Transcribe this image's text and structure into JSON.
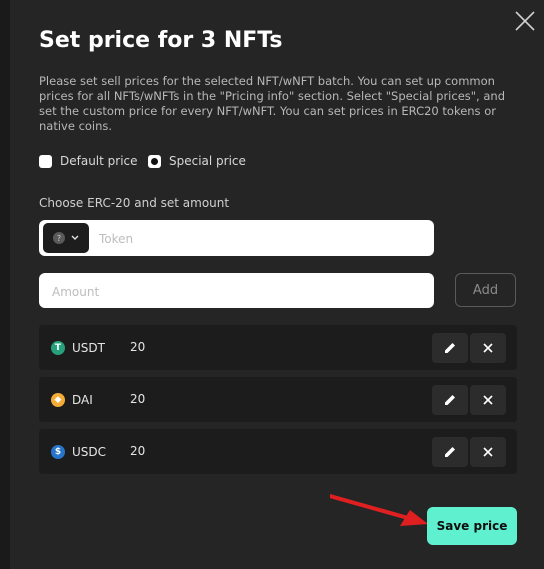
{
  "modal": {
    "title": "Set price for 3 NFTs",
    "description": "Please set sell prices for the selected NFT/wNFT batch. You can set up common prices for all NFTs/wNFTs in the \"Pricing info\" section. Select \"Special prices\", and set the custom price for every NFT/wNFT. You can set prices in ERC20 tokens or native coins.",
    "close_icon": "close-icon"
  },
  "price_mode": {
    "options": [
      {
        "label": "Default price",
        "selected": false
      },
      {
        "label": "Special price",
        "selected": true
      }
    ]
  },
  "token_section": {
    "label": "Choose ERC-20 and set amount",
    "token_placeholder": "Token",
    "token_icon": "question-icon",
    "amount_placeholder": "Amount",
    "add_label": "Add"
  },
  "prices": [
    {
      "symbol": "USDT",
      "amount": "20",
      "icon": "tether-icon",
      "color": "#26a17b"
    },
    {
      "symbol": "DAI",
      "amount": "20",
      "icon": "dai-icon",
      "color": "#f5ac37"
    },
    {
      "symbol": "USDC",
      "amount": "20",
      "icon": "usdc-icon",
      "color": "#2775ca"
    }
  ],
  "actions": {
    "save_label": "Save price",
    "accent_color": "#5ff0d0",
    "arrow_color": "#e02020"
  }
}
